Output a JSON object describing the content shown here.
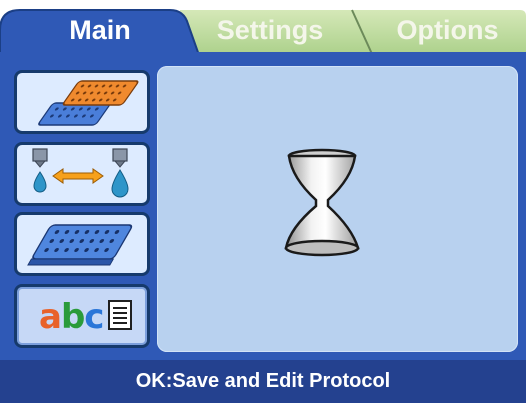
{
  "tabs": [
    {
      "label": "Main",
      "active": true
    },
    {
      "label": "Settings",
      "active": false
    },
    {
      "label": "Options",
      "active": false
    }
  ],
  "sidebar": {
    "buttons": [
      {
        "name": "plates-button",
        "icon": "stacked-plates-icon"
      },
      {
        "name": "dispense-button",
        "icon": "liquid-transfer-icon"
      },
      {
        "name": "plate-button",
        "icon": "well-plate-icon"
      },
      {
        "name": "text-button",
        "icon": "abc-text-icon",
        "text": "abc",
        "selected": true
      }
    ]
  },
  "main": {
    "busy_indicator": "hourglass-icon"
  },
  "status": {
    "text": "OK:Save and Edit Protocol"
  },
  "colors": {
    "frame": "#2f59b6",
    "content_bg": "#b8d1ef",
    "status_bar": "#24418f",
    "inactive_tab": "#bcd9a0"
  }
}
